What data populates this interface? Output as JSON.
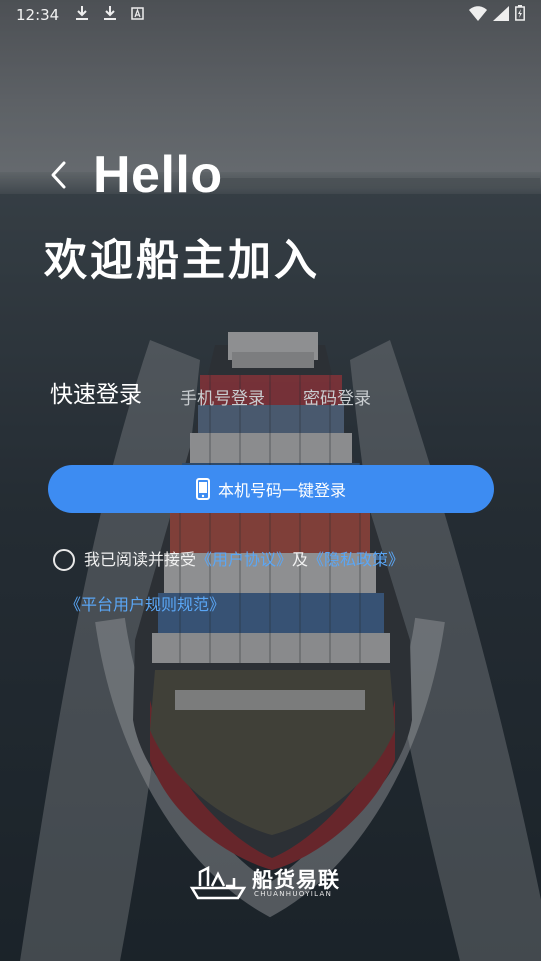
{
  "status_bar": {
    "time": "12:34",
    "icons": [
      "download-icon",
      "download-icon",
      "a-box-icon"
    ],
    "right_icons": [
      "wifi-icon",
      "signal-icon",
      "battery-icon"
    ]
  },
  "header": {
    "back_icon": "chevron-left-icon",
    "hello": "Hello",
    "welcome": "欢迎船主加入"
  },
  "tabs": [
    {
      "label": "快速登录",
      "active": true
    },
    {
      "label": "手机号登录",
      "active": false
    },
    {
      "label": "密码登录",
      "active": false
    }
  ],
  "login_button": {
    "icon": "mobile-phone-icon",
    "label": "本机号码一键登录",
    "color": "#3d8cf2"
  },
  "agreement": {
    "prefix": "我已阅读并接受",
    "user_agreement": "《用户协议》",
    "and": "及",
    "privacy_policy": "《隐私政策》",
    "platform_rules": "《平台用户规则规范》",
    "link_color": "#5aa6f5"
  },
  "brand": {
    "name_cn": "船货易联",
    "name_en": "CHUANHUOYILAN"
  }
}
